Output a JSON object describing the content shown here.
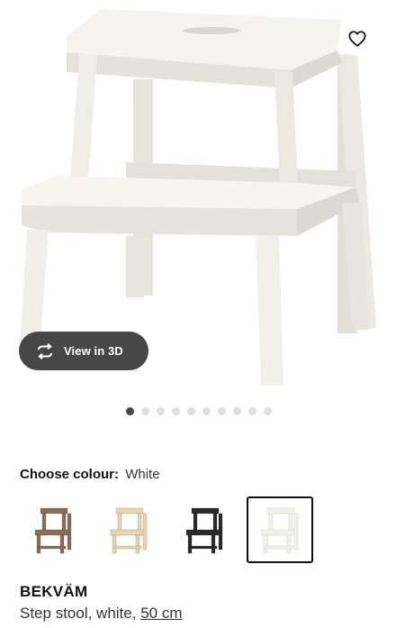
{
  "product_image": {
    "favourite_icon": "heart-outline-icon",
    "view_3d": {
      "label": "View in 3D",
      "icon": "rotate-3d-icon"
    },
    "carousel": {
      "total": 10,
      "active_index": 0
    }
  },
  "colour": {
    "label": "Choose colour:",
    "value": "White",
    "options": [
      {
        "name": "brown",
        "color": "#8a6f58"
      },
      {
        "name": "birch",
        "color": "#e8d6b0"
      },
      {
        "name": "black",
        "color": "#2b2b2b"
      },
      {
        "name": "white",
        "color": "#f2f1ec",
        "selected": true
      }
    ]
  },
  "product": {
    "name": "BEKVÄM",
    "description": "Step stool, white,",
    "size_link": "50 cm"
  }
}
